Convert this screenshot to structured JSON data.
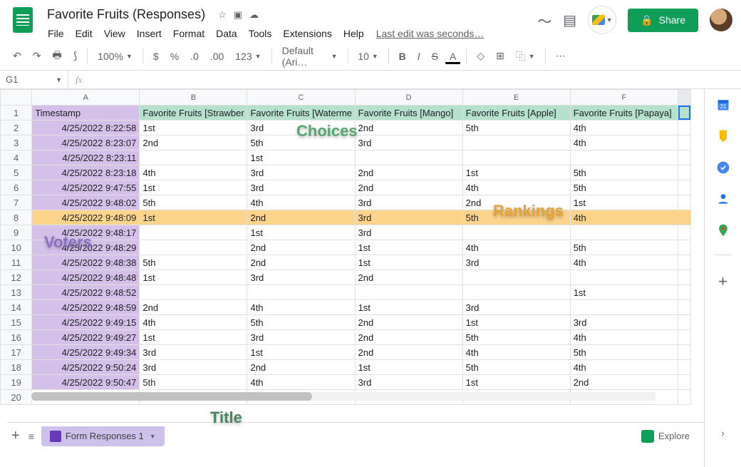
{
  "doc_title": "Favorite Fruits (Responses)",
  "menus": [
    "File",
    "Edit",
    "View",
    "Insert",
    "Format",
    "Data",
    "Tools",
    "Extensions",
    "Help"
  ],
  "last_edit": "Last edit was seconds…",
  "share_label": "Share",
  "zoom": "100%",
  "font": "Default (Ari…",
  "font_size": "10",
  "namebox": "G1",
  "columns": [
    "A",
    "B",
    "C",
    "D",
    "E",
    "F"
  ],
  "headers": [
    "Timestamp",
    "Favorite Fruits [Strawber",
    "Favorite Fruits [Waterme",
    "Favorite Fruits [Mango]",
    "Favorite Fruits [Apple]",
    "Favorite Fruits [Papaya]"
  ],
  "rows": [
    {
      "n": 2,
      "ts": "4/25/2022 8:22:58",
      "v": [
        "1st",
        "3rd",
        "2nd",
        "5th",
        "4th"
      ]
    },
    {
      "n": 3,
      "ts": "4/25/2022 8:23:07",
      "v": [
        "2nd",
        "5th",
        "3rd",
        "",
        "4th"
      ]
    },
    {
      "n": 4,
      "ts": "4/25/2022 8:23:11",
      "v": [
        "",
        "1st",
        "",
        "",
        ""
      ]
    },
    {
      "n": 5,
      "ts": "4/25/2022 8:23:18",
      "v": [
        "4th",
        "3rd",
        "2nd",
        "1st",
        "5th"
      ]
    },
    {
      "n": 6,
      "ts": "4/25/2022 9:47:55",
      "v": [
        "1st",
        "3rd",
        "2nd",
        "4th",
        "5th"
      ]
    },
    {
      "n": 7,
      "ts": "4/25/2022 9:48:02",
      "v": [
        "5th",
        "4th",
        "3rd",
        "2nd",
        "1st"
      ]
    },
    {
      "n": 8,
      "ts": "4/25/2022 9:48:09",
      "v": [
        "1st",
        "2nd",
        "3rd",
        "5th",
        "4th"
      ],
      "hl": true
    },
    {
      "n": 9,
      "ts": "4/25/2022 9:48:17",
      "v": [
        "",
        "1st",
        "3rd",
        "",
        ""
      ]
    },
    {
      "n": 10,
      "ts": "4/25/2022 9:48:29",
      "v": [
        "",
        "2nd",
        "1st",
        "4th",
        "5th"
      ]
    },
    {
      "n": 11,
      "ts": "4/25/2022 9:48:38",
      "v": [
        "5th",
        "2nd",
        "1st",
        "3rd",
        "4th"
      ]
    },
    {
      "n": 12,
      "ts": "4/25/2022 9:48:48",
      "v": [
        "1st",
        "3rd",
        "2nd",
        "",
        ""
      ]
    },
    {
      "n": 13,
      "ts": "4/25/2022 9:48:52",
      "v": [
        "",
        "",
        "",
        "",
        "1st"
      ]
    },
    {
      "n": 14,
      "ts": "4/25/2022 9:48:59",
      "v": [
        "2nd",
        "4th",
        "1st",
        "3rd",
        ""
      ]
    },
    {
      "n": 15,
      "ts": "4/25/2022 9:49:15",
      "v": [
        "4th",
        "5th",
        "2nd",
        "1st",
        "3rd"
      ]
    },
    {
      "n": 16,
      "ts": "4/25/2022 9:49:27",
      "v": [
        "1st",
        "3rd",
        "2nd",
        "5th",
        "4th"
      ]
    },
    {
      "n": 17,
      "ts": "4/25/2022 9:49:34",
      "v": [
        "3rd",
        "1st",
        "2nd",
        "4th",
        "5th"
      ]
    },
    {
      "n": 18,
      "ts": "4/25/2022 9:50:24",
      "v": [
        "3rd",
        "2nd",
        "1st",
        "5th",
        "4th"
      ]
    },
    {
      "n": 19,
      "ts": "4/25/2022 9:50:47",
      "v": [
        "5th",
        "4th",
        "3rd",
        "1st",
        "2nd"
      ]
    }
  ],
  "empty_row": 20,
  "sheet_tab": "Form Responses 1",
  "explore": "Explore",
  "annotations": {
    "choices": "Choices",
    "voters": "Voters",
    "rankings": "Rankings",
    "title": "Title"
  }
}
